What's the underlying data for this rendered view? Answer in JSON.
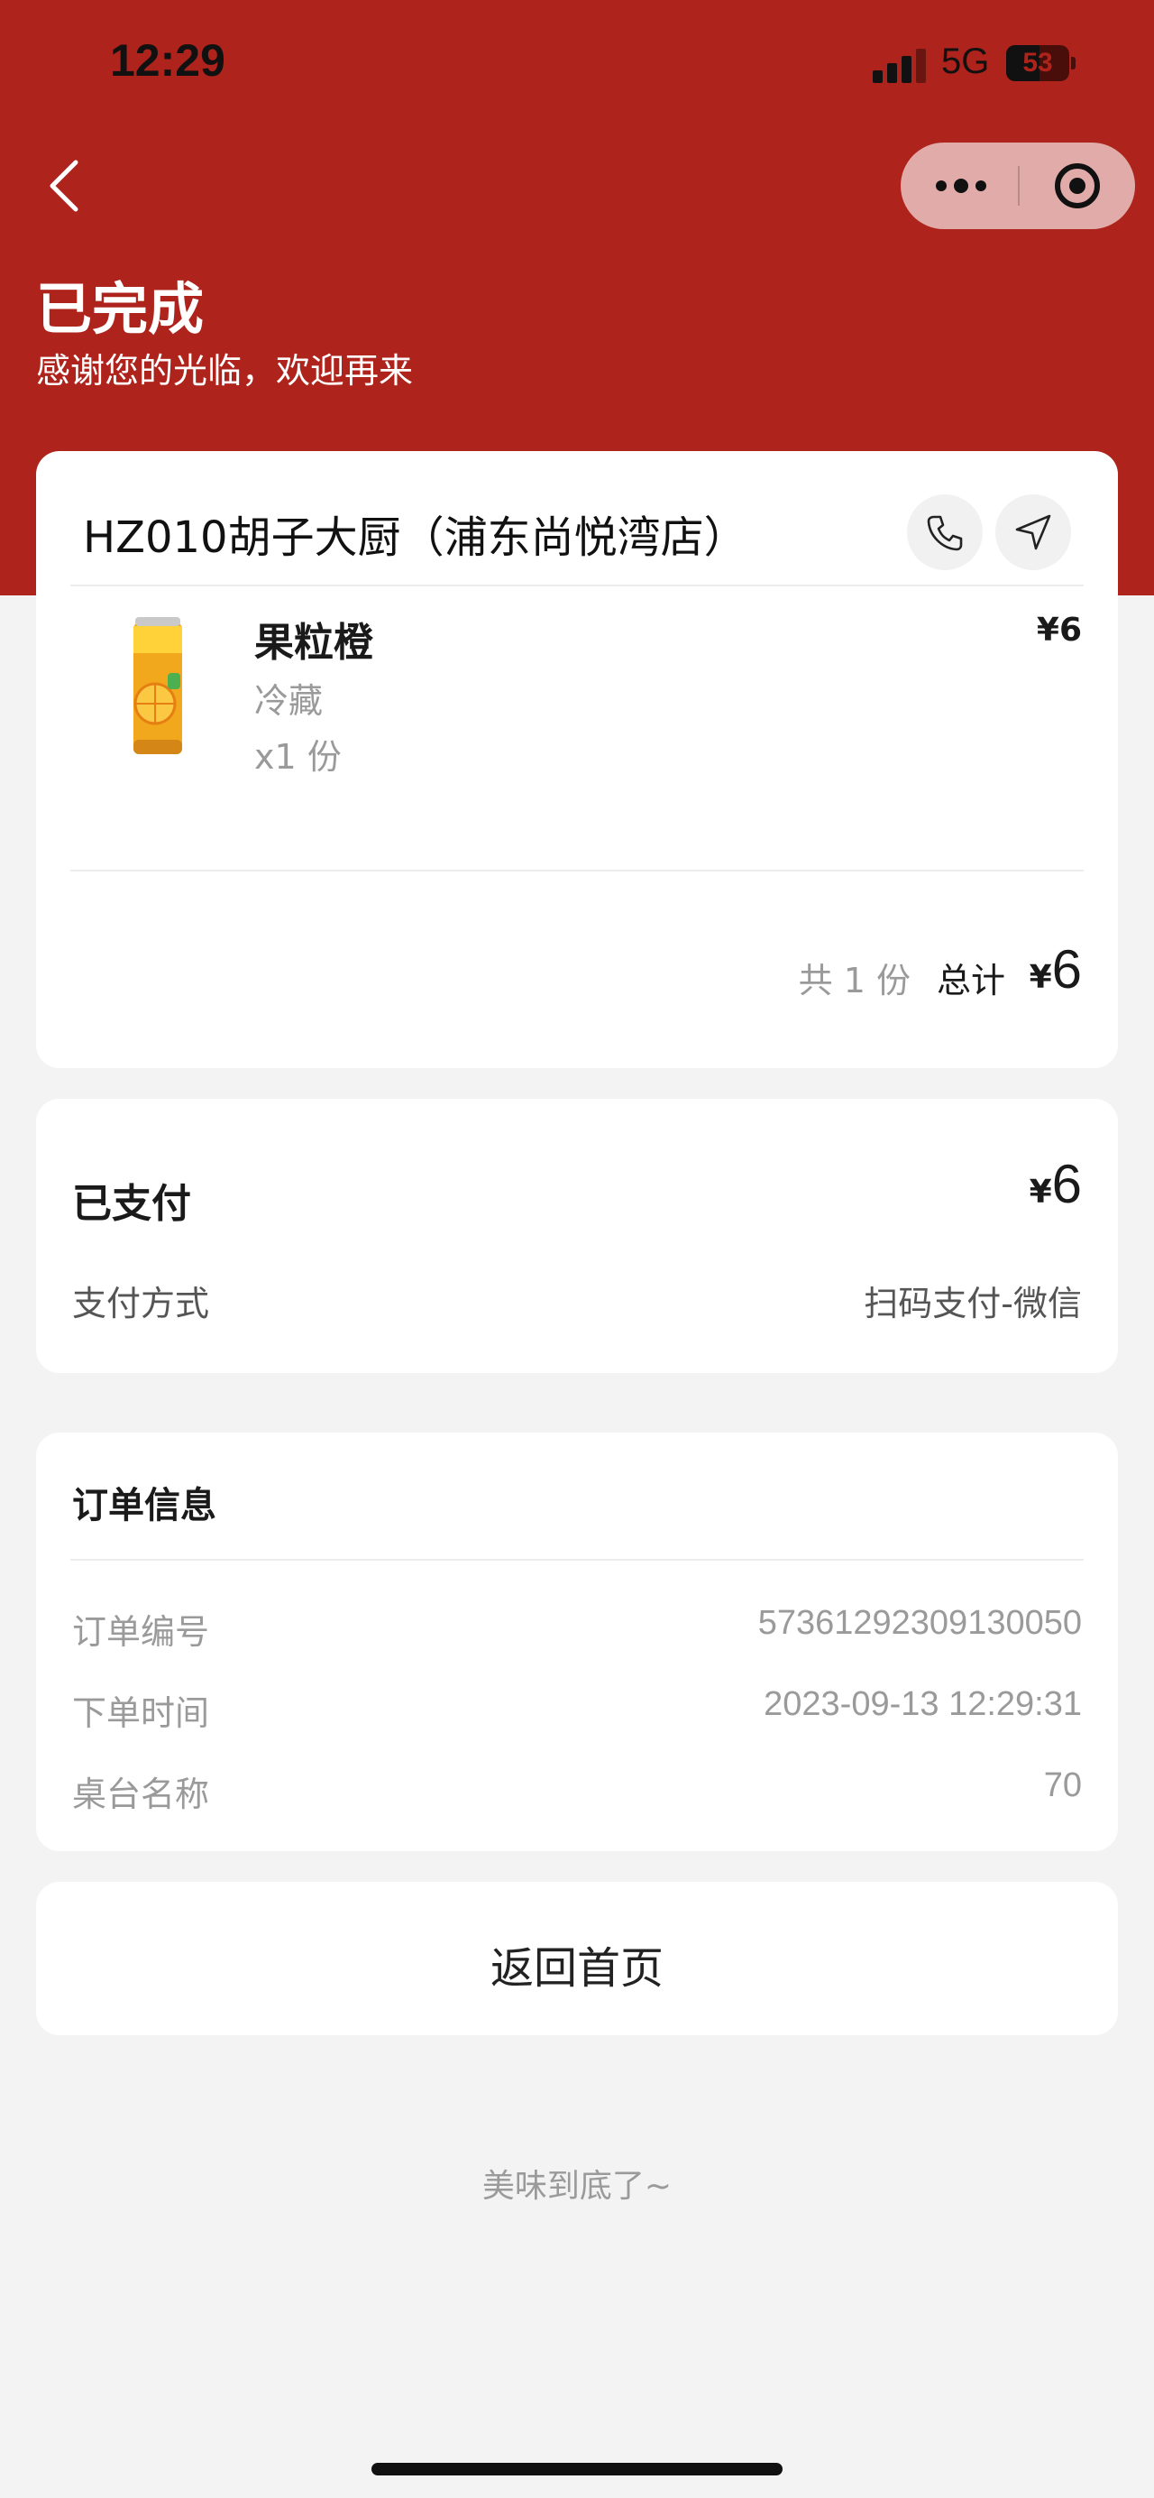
{
  "status_bar": {
    "time": "12:29",
    "network": "5G",
    "battery_percent": "53",
    "battery_level": 0.53,
    "signal_bars_active": 3
  },
  "nav": {
    "back_icon": "chevron-left-icon",
    "more_icon": "more-dots-icon",
    "close_icon": "target-close-icon"
  },
  "order_status": {
    "title": "已完成",
    "subtitle": "感谢您的光临，欢迎再来"
  },
  "store": {
    "name": "HZ010胡子大厨（浦东尚悦湾店）",
    "phone_icon": "phone-icon",
    "navigate_icon": "location-arrow-icon"
  },
  "items": [
    {
      "name": "果粒橙",
      "spec": "冷藏",
      "quantity": "x1 份",
      "price": "¥6",
      "image_icon": "orange-juice-can-icon"
    }
  ],
  "summary": {
    "count_text": "共 1 份",
    "total_label": "总计",
    "currency": "¥",
    "total_amount": "6"
  },
  "payment": {
    "paid_label": "已支付",
    "currency": "¥",
    "paid_amount": "6",
    "method_label": "支付方式",
    "method_value": "扫码支付-微信"
  },
  "order_info": {
    "title": "订单信息",
    "rows": [
      {
        "key": "订单编号",
        "value": "57361292309130050"
      },
      {
        "key": "下单时间",
        "value": "2023-09-13 12:29:31"
      },
      {
        "key": "桌台名称",
        "value": "70"
      }
    ]
  },
  "actions": {
    "home_label": "返回首页"
  },
  "footer": {
    "end_text": "美味到底了~"
  },
  "colors": {
    "brand_red": "#ae231b",
    "page_bg": "#f3f3f3",
    "card_bg": "#ffffff",
    "muted_text": "#9a9a9a"
  }
}
